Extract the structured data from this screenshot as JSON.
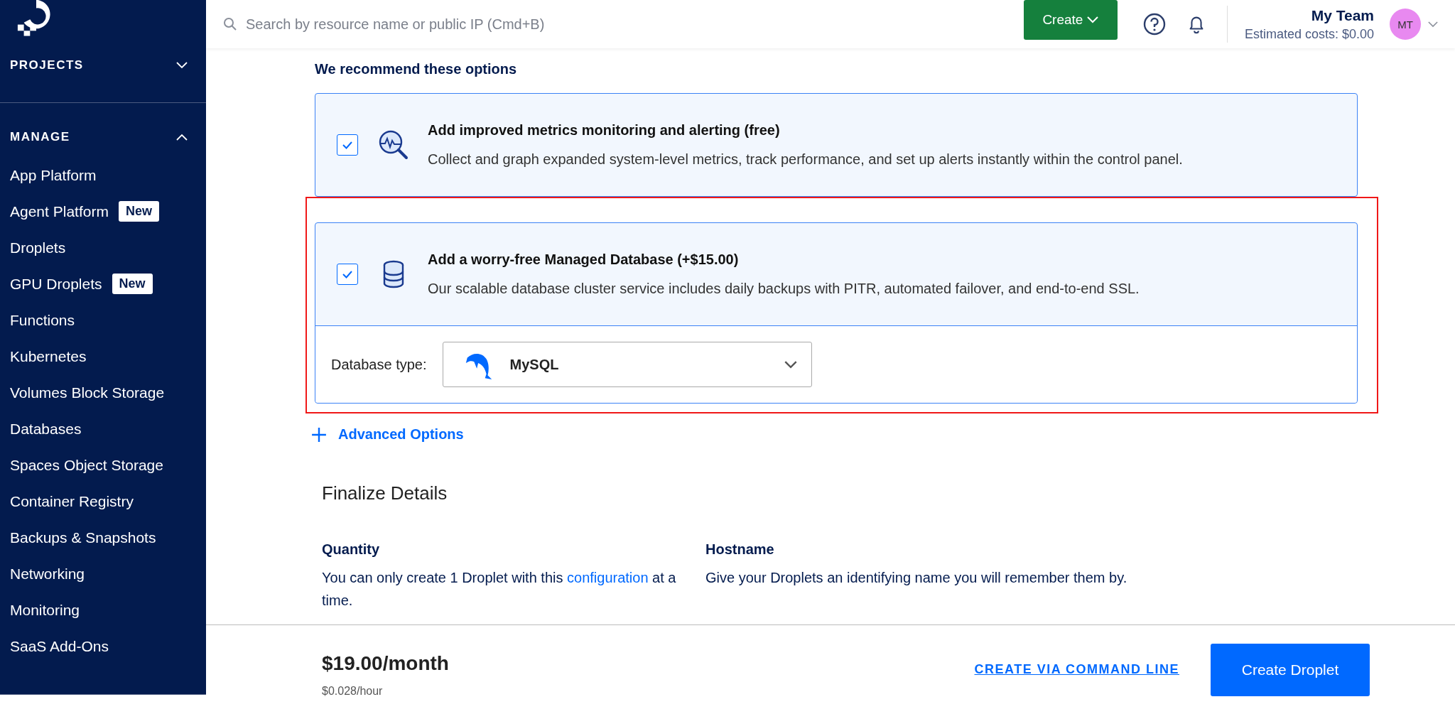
{
  "sidebar": {
    "sections": [
      {
        "title": "PROJECTS",
        "expanded": false
      },
      {
        "title": "MANAGE",
        "expanded": true,
        "items": [
          {
            "label": "App Platform"
          },
          {
            "label": "Agent Platform",
            "badge": "New"
          },
          {
            "label": "Droplets"
          },
          {
            "label": "GPU Droplets",
            "badge": "New"
          },
          {
            "label": "Functions"
          },
          {
            "label": "Kubernetes"
          },
          {
            "label": "Volumes Block Storage"
          },
          {
            "label": "Databases"
          },
          {
            "label": "Spaces Object Storage"
          },
          {
            "label": "Container Registry"
          },
          {
            "label": "Backups & Snapshots"
          },
          {
            "label": "Networking"
          },
          {
            "label": "Monitoring"
          },
          {
            "label": "SaaS Add-Ons"
          }
        ]
      }
    ]
  },
  "topbar": {
    "search": {
      "placeholder": "Search by resource name or public IP (Cmd+B)"
    },
    "create_button": "Create",
    "team": "My Team",
    "costs": "Estimated costs: $0.00",
    "avatar": "MT"
  },
  "recommend": {
    "heading": "We recommend these options",
    "options": [
      {
        "kind": "metrics",
        "title": "Add improved metrics monitoring and alerting (free)",
        "description": "Collect and graph expanded system-level metrics, track performance, and set up alerts instantly within the control panel.",
        "checked": true,
        "highlighted": false
      },
      {
        "kind": "database",
        "title": "Add a worry-free Managed Database (+$15.00)",
        "description": "Our scalable database cluster service includes daily backups with PITR, automated failover, and end-to-end SSL.",
        "checked": true,
        "highlighted": true,
        "field": {
          "label": "Database type:",
          "value": "MySQL"
        }
      }
    ]
  },
  "advanced_options": "Advanced Options",
  "finalize": {
    "title": "Finalize Details",
    "quantity": {
      "label": "Quantity",
      "text": "You can only create 1 Droplet with this",
      "link": "configuration",
      "after": "at a time."
    },
    "hostname": {
      "label": "Hostname",
      "text": "Give your Droplets an identifying name you will remember them by."
    }
  },
  "footer": {
    "price": "$19.00/month",
    "hourly": "$0.028/hour",
    "cli_link": "CREATE VIA COMMAND LINE",
    "create_button": "Create Droplet"
  }
}
